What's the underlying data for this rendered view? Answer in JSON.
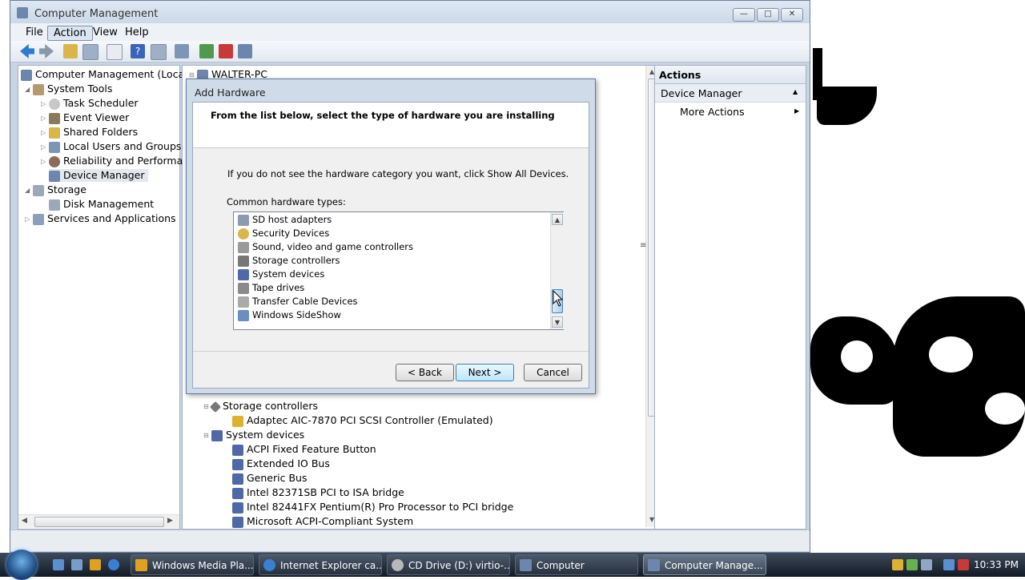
{
  "window": {
    "title": "Computer Management"
  },
  "menu": [
    "File",
    "Action",
    "View",
    "Help"
  ],
  "menu_active": "Action",
  "tree": {
    "root": "Computer Management (Local",
    "system_tools": "System Tools",
    "task_scheduler": "Task Scheduler",
    "event_viewer": "Event Viewer",
    "shared_folders": "Shared Folders",
    "local_users": "Local Users and Groups",
    "reliability": "Reliability and Performa",
    "device_manager": "Device Manager",
    "storage": "Storage",
    "disk_management": "Disk Management",
    "services": "Services and Applications"
  },
  "center": {
    "computer": "WALTER-PC",
    "storage_controllers": "Storage controllers",
    "adaptec": "Adaptec AIC-7870 PCI SCSI Controller (Emulated)",
    "system_devices": "System devices",
    "devices": [
      "ACPI Fixed Feature Button",
      "Extended IO Bus",
      "Generic Bus",
      "Intel 82371SB PCI to ISA bridge",
      "Intel 82441FX Pentium(R) Pro Processor to PCI bridge",
      "Microsoft ACPI-Compliant System"
    ]
  },
  "actions": {
    "header": "Actions",
    "section": "Device Manager",
    "more": "More Actions"
  },
  "dialog": {
    "title": "Add Hardware",
    "heading": "From the list below, select the type of hardware you are installing",
    "info": "If you do not see the hardware category you want, click Show All Devices.",
    "list_label": "Common hardware types:",
    "items": [
      "SD host adapters",
      "Security Devices",
      "Sound, video and game controllers",
      "Storage controllers",
      "System devices",
      "Tape drives",
      "Transfer Cable Devices",
      "Windows SideShow"
    ],
    "back": "< Back",
    "next": "Next >",
    "cancel": "Cancel"
  },
  "taskbar": {
    "tasks": [
      "Windows Media Pla...",
      "Internet Explorer ca...",
      "CD Drive (D:) virtio-...",
      "Computer",
      "Computer Manage..."
    ],
    "clock": "10:33 PM"
  },
  "colors": {
    "accent": "#3c7fb1",
    "title_bg": "#c9d6e6",
    "taskbar": "#1b2532"
  }
}
